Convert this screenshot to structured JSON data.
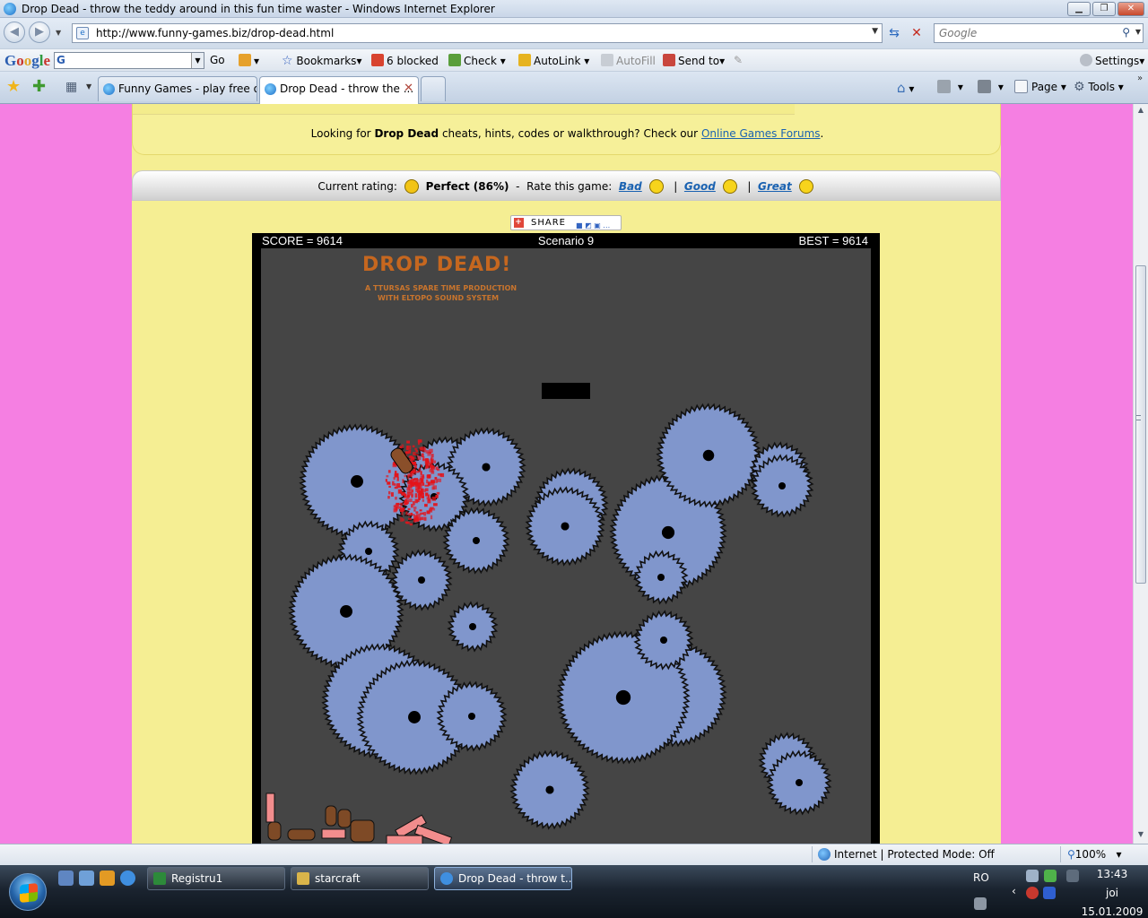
{
  "window": {
    "title": "Drop Dead - throw the teddy around in this fun time waster - Windows Internet Explorer",
    "url": "http://www.funny-games.biz/drop-dead.html",
    "search_placeholder": "Google"
  },
  "google_toolbar": {
    "logo_letters": [
      "G",
      "o",
      "o",
      "g",
      "l",
      "e"
    ],
    "search_prefix": "G",
    "go": "Go",
    "bookmarks": "Bookmarks",
    "blocked": "6 blocked",
    "check": "Check",
    "autolink": "AutoLink",
    "autofill": "AutoFill",
    "send_to": "Send to",
    "settings": "Settings"
  },
  "tabs": [
    {
      "label": "Funny Games - play free o..."
    },
    {
      "label": "Drop Dead - throw the ..."
    }
  ],
  "command_bar": {
    "page": "Page",
    "tools": "Tools"
  },
  "page": {
    "cheats": {
      "prefix": "Looking for",
      "game": "Drop Dead",
      "suffix": "cheats, hints, codes or walkthrough? Check our",
      "link": "Online Games Forums",
      "end": "."
    },
    "rating": {
      "current_label": "Current rating:",
      "current_value": "Perfect (86%)",
      "dash": "-",
      "rate_label": "Rate this game:",
      "bad": "Bad",
      "good": "Good",
      "great": "Great",
      "sep": "|"
    },
    "share": "SHARE"
  },
  "game": {
    "score": "SCORE = 9614",
    "scenario": "Scenario 9",
    "best": "BEST = 9614",
    "title": "DROP DEAD!",
    "credit_1": "A TTURSAS  SPARE TIME PRODUCTION",
    "credit_2": "WITH ELTOPO  SOUND SYSTEM",
    "colors": {
      "saw": "#8096cc",
      "field": "#454545",
      "blood": "#e3141b",
      "title": "#c6671f",
      "brick": "#f28d8d"
    }
  },
  "statusbar": {
    "zone": "Internet | Protected Mode: Off",
    "zoom": "100%"
  },
  "taskbar": {
    "items": [
      {
        "label": "Registru1"
      },
      {
        "label": "starcraft"
      },
      {
        "label": "Drop Dead - throw t..."
      }
    ],
    "language": "RO",
    "time": "13:43",
    "day": "joi",
    "date": "15.01.2009"
  }
}
